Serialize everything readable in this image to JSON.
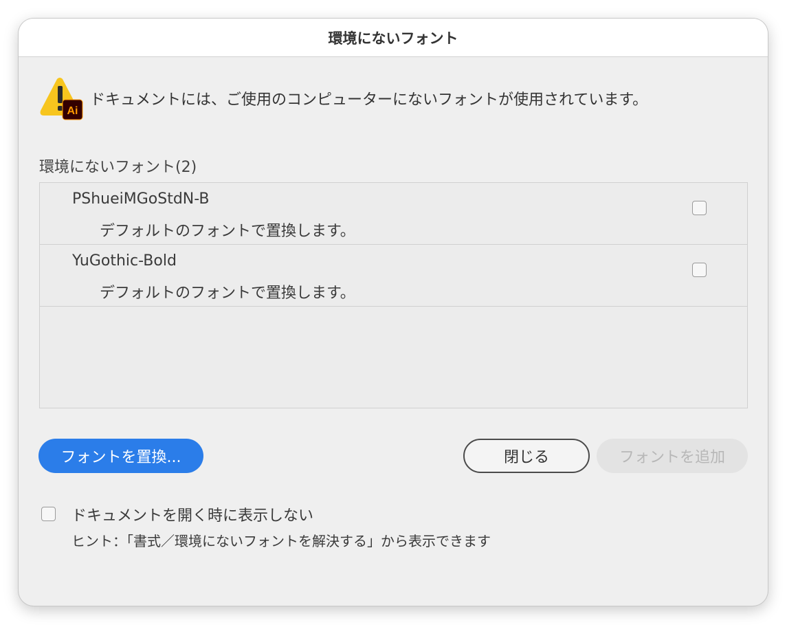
{
  "dialog": {
    "title": "環境にないフォント",
    "message": "ドキュメントには、ご使用のコンピューターにないフォントが使用されています。",
    "app_badge": "Ai",
    "list_heading": "環境にないフォント(2)",
    "fonts": [
      {
        "name": "PShueiMGoStdN-B",
        "note": "デフォルトのフォントで置換します。",
        "checked": false
      },
      {
        "name": "YuGothic-Bold",
        "note": "デフォルトのフォントで置換します。",
        "checked": false
      }
    ],
    "buttons": {
      "replace": "フォントを置換...",
      "close": "閉じる",
      "add": "フォントを追加"
    },
    "footer": {
      "dont_show_label": "ドキュメントを開く時に表示しない",
      "dont_show_checked": false,
      "hint": "ヒント：「書式／環境にないフォントを解決する」から表示できます"
    }
  },
  "colors": {
    "primary_button": "#2b7de9",
    "warning_yellow": "#f7c51e",
    "ai_badge_bg": "#330000",
    "ai_badge_text": "#ff9a00",
    "dialog_bg": "#efefef"
  },
  "icons": {
    "warning": "warning-triangle-icon",
    "app": "illustrator-badge-icon"
  }
}
